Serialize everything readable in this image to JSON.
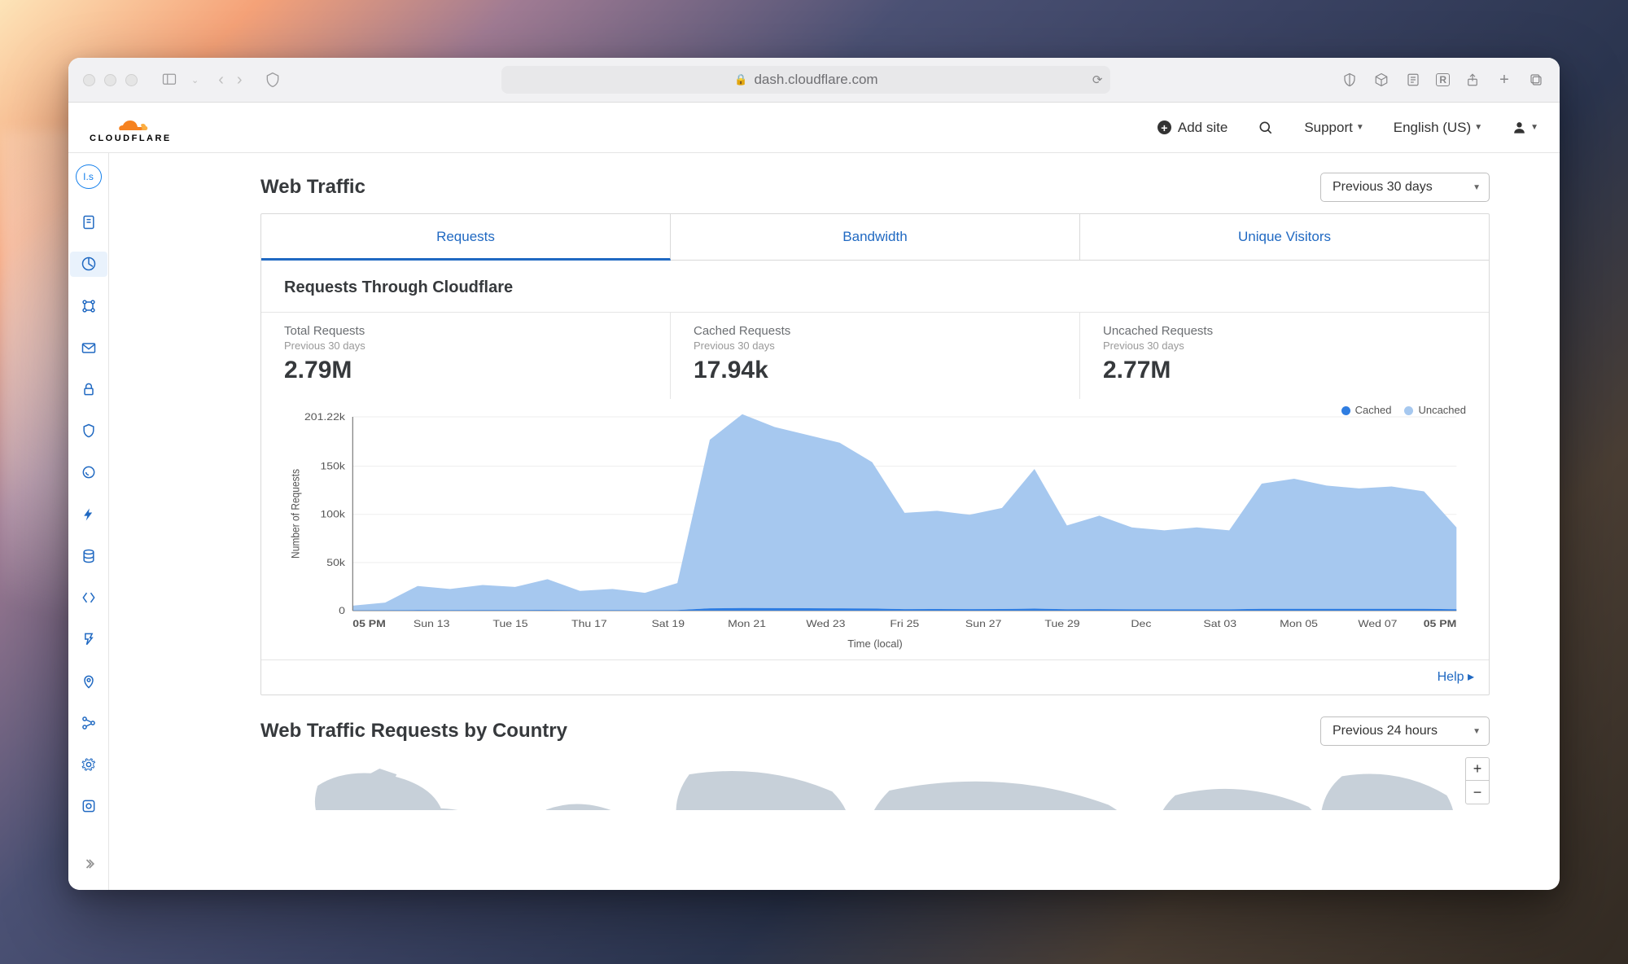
{
  "browser": {
    "url": "dash.cloudflare.com"
  },
  "header": {
    "logo_text": "CLOUDFLARE",
    "add_site": "Add site",
    "support": "Support",
    "language": "English (US)"
  },
  "sidebar": {
    "account_initials": "I.s"
  },
  "traffic": {
    "title": "Web Traffic",
    "range": "Previous 30 days",
    "tabs": [
      "Requests",
      "Bandwidth",
      "Unique Visitors"
    ],
    "chart_title": "Requests Through Cloudflare",
    "stats": [
      {
        "label": "Total Requests",
        "period": "Previous 30 days",
        "value": "2.79M"
      },
      {
        "label": "Cached Requests",
        "period": "Previous 30 days",
        "value": "17.94k"
      },
      {
        "label": "Uncached Requests",
        "period": "Previous 30 days",
        "value": "2.77M"
      }
    ],
    "legend": {
      "cached": "Cached",
      "uncached": "Uncached"
    },
    "y_title": "Number of Requests",
    "x_title": "Time (local)",
    "help": "Help"
  },
  "country": {
    "title": "Web Traffic Requests by Country",
    "range": "Previous 24 hours"
  },
  "colors": {
    "cached": "#2f7de1",
    "uncached": "#a6c8ef"
  },
  "chart_data": {
    "type": "area",
    "title": "Requests Through Cloudflare",
    "xlabel": "Time (local)",
    "ylabel": "Number of Requests",
    "ylim": [
      0,
      201220
    ],
    "y_ticks": [
      0,
      50000,
      100000,
      150000,
      201220
    ],
    "y_tick_labels": [
      "0",
      "50k",
      "100k",
      "150k",
      "201.22k"
    ],
    "x_tick_labels": [
      "05 PM",
      "Sun 13",
      "Tue 15",
      "Thu 17",
      "Sat 19",
      "Mon 21",
      "Wed 23",
      "Fri 25",
      "Sun 27",
      "Tue 29",
      "Dec",
      "Sat 03",
      "Mon 05",
      "Wed 07",
      "05 PM"
    ],
    "series": [
      {
        "name": "Uncached",
        "color": "#a6c8ef",
        "values": [
          5000,
          8000,
          25000,
          22000,
          26000,
          24000,
          32000,
          20000,
          22000,
          18000,
          28000,
          175000,
          201220,
          188000,
          180000,
          172000,
          152000,
          100000,
          102000,
          98000,
          105000,
          145000,
          87000,
          97000,
          85000,
          82000,
          85000,
          82000,
          130000,
          135000,
          128000,
          125000,
          127000,
          122000,
          85000
        ]
      },
      {
        "name": "Cached",
        "color": "#2f7de1",
        "values": [
          200,
          300,
          600,
          550,
          620,
          600,
          700,
          500,
          540,
          480,
          640,
          2400,
          2800,
          2600,
          2500,
          2400,
          2200,
          1600,
          1650,
          1600,
          1680,
          2100,
          1450,
          1550,
          1420,
          1400,
          1420,
          1400,
          1900,
          1950,
          1900,
          1880,
          1890,
          1860,
          1450
        ]
      }
    ]
  }
}
